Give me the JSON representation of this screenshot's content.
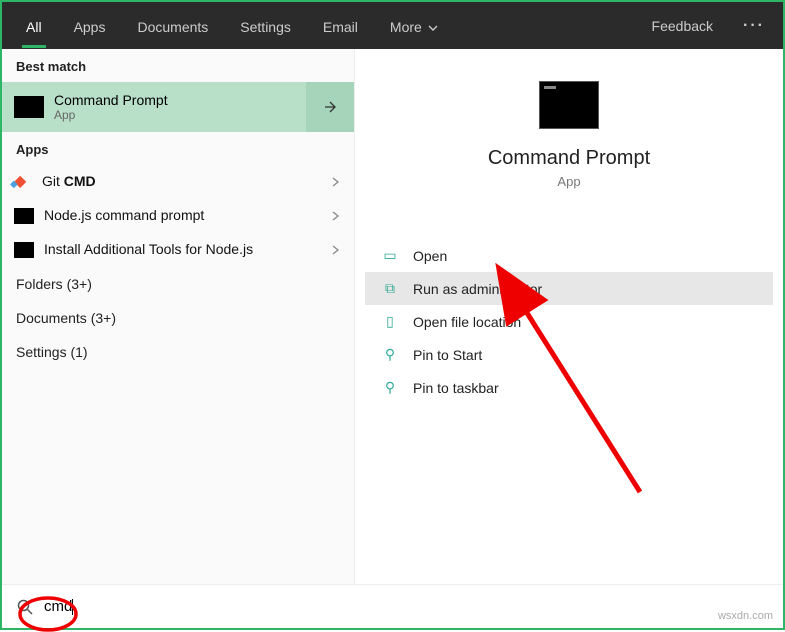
{
  "header": {
    "tabs": [
      "All",
      "Apps",
      "Documents",
      "Settings",
      "Email",
      "More"
    ],
    "feedback": "Feedback"
  },
  "left": {
    "best_match": "Best match",
    "selected": {
      "title": "Command Prompt",
      "sub": "App"
    },
    "apps_label": "Apps",
    "apps": [
      {
        "title_pre": "Git ",
        "title_bold": "CMD"
      },
      {
        "title_pre": "Node.js command prompt",
        "title_bold": ""
      },
      {
        "title_pre": "Install Additional Tools for Node.js",
        "title_bold": ""
      }
    ],
    "categories": [
      "Folders (3+)",
      "Documents (3+)",
      "Settings (1)"
    ]
  },
  "right": {
    "title": "Command Prompt",
    "sub": "App",
    "actions": [
      "Open",
      "Run as administrator",
      "Open file location",
      "Pin to Start",
      "Pin to taskbar"
    ]
  },
  "search": {
    "value": "cmd"
  },
  "watermark": "wsxdn.com"
}
